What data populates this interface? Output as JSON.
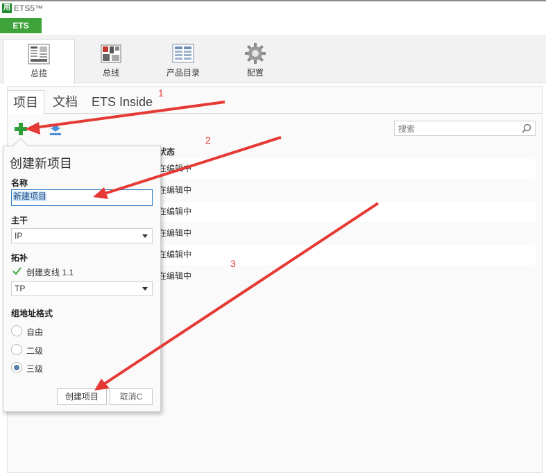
{
  "app": {
    "logo": "用",
    "title": "ETS5™",
    "tab": "ETS"
  },
  "ribbon": [
    {
      "label": "总揽",
      "icon": "overview-icon"
    },
    {
      "label": "总线",
      "icon": "bus-icon"
    },
    {
      "label": "产品目录",
      "icon": "catalog-icon"
    },
    {
      "label": "配置",
      "icon": "settings-gear-icon"
    }
  ],
  "tabs": [
    {
      "label": "项目"
    },
    {
      "label": "文档"
    },
    {
      "label": "ETS Inside"
    }
  ],
  "search": {
    "placeholder": "搜索"
  },
  "table": {
    "status_header": "状态",
    "rows": [
      "在编辑中",
      "在编辑中",
      "在编辑中",
      "在编辑中",
      "在编辑中",
      "在编辑中"
    ]
  },
  "popup": {
    "title": "创建新项目",
    "name_label": "名称",
    "name_value": "新建项目",
    "backbone_label": "主干",
    "backbone_value": "IP",
    "topology_label": "拓补",
    "create_line_label": "创建支线 1.1",
    "create_line_checked": true,
    "topology_value": "TP",
    "address_label": "组地址格式",
    "address_options": [
      "自由",
      "二级",
      "三级"
    ],
    "address_selected": "三级",
    "create_button": "创建项目",
    "cancel_button": "取消C"
  },
  "annotations": [
    "1",
    "2",
    "3"
  ],
  "colors": {
    "brand_green": "#3ea33a",
    "annotation_red": "#e53935",
    "selection_blue": "#2b78c4"
  }
}
